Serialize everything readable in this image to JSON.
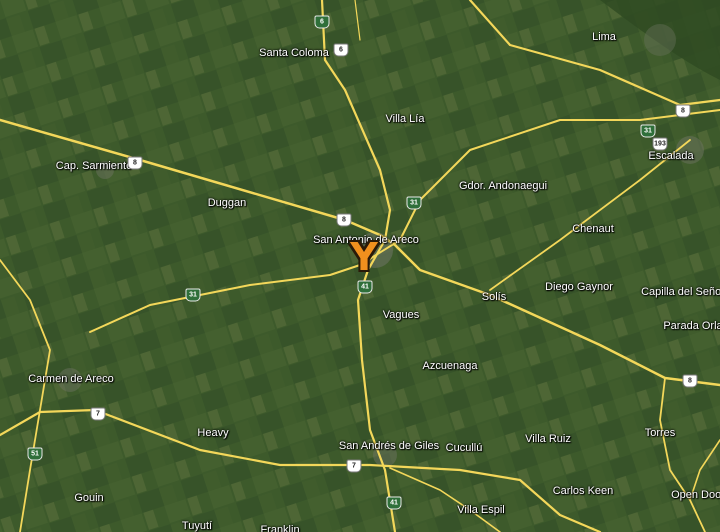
{
  "map": {
    "marker": {
      "glyph": "Y",
      "color": "#f0901e"
    },
    "road_color": "#f3d75a",
    "places": [
      {
        "id": "santa-coloma",
        "name": "Santa Coloma"
      },
      {
        "id": "lima",
        "name": "Lima"
      },
      {
        "id": "villa-lia",
        "name": "Villa Lía"
      },
      {
        "id": "cap-sarmiento",
        "name": "Cap. Sarmiento"
      },
      {
        "id": "escalada",
        "name": "Escalada"
      },
      {
        "id": "gdor-andonaegui",
        "name": "Gdor. Andonaegui"
      },
      {
        "id": "duggan",
        "name": "Duggan"
      },
      {
        "id": "san-antonio-de-areco",
        "name": "San Antonio de Areco"
      },
      {
        "id": "chenaut",
        "name": "Chenaut"
      },
      {
        "id": "solis",
        "name": "Solís"
      },
      {
        "id": "diego-gaynor",
        "name": "Diego Gaynor"
      },
      {
        "id": "capilla-del-senor",
        "name": "Capilla del Señor"
      },
      {
        "id": "vagues",
        "name": "Vagues"
      },
      {
        "id": "parada-orlando",
        "name": "Parada Orla"
      },
      {
        "id": "azcuenaga",
        "name": "Azcuenaga"
      },
      {
        "id": "carmen-de-areco",
        "name": "Carmen de Areco"
      },
      {
        "id": "heavy",
        "name": "Heavy"
      },
      {
        "id": "san-andres-de-giles",
        "name": "San Andrés de Giles"
      },
      {
        "id": "cucullu",
        "name": "Cucullú"
      },
      {
        "id": "villa-ruiz",
        "name": "Villa Ruiz"
      },
      {
        "id": "torres",
        "name": "Torres"
      },
      {
        "id": "carlos-keen",
        "name": "Carlos Keen"
      },
      {
        "id": "gouin",
        "name": "Gouin"
      },
      {
        "id": "open-door",
        "name": "Open Door"
      },
      {
        "id": "villa-espil",
        "name": "Villa Espil"
      },
      {
        "id": "tuyuti",
        "name": "Tuyutí"
      },
      {
        "id": "franklin",
        "name": "Franklin"
      }
    ],
    "shields": [
      {
        "id": "s8a",
        "number": "8",
        "style": "white"
      },
      {
        "id": "s8b",
        "number": "8",
        "style": "white"
      },
      {
        "id": "s8c",
        "number": "8",
        "style": "white"
      },
      {
        "id": "s8d",
        "number": "8",
        "style": "white"
      },
      {
        "id": "s31a",
        "number": "31",
        "style": "green"
      },
      {
        "id": "s31b",
        "number": "31",
        "style": "green"
      },
      {
        "id": "s31c",
        "number": "31",
        "style": "green"
      },
      {
        "id": "s41a",
        "number": "41",
        "style": "green"
      },
      {
        "id": "s41b",
        "number": "41",
        "style": "green"
      },
      {
        "id": "s7a",
        "number": "7",
        "style": "white"
      },
      {
        "id": "s7b",
        "number": "7",
        "style": "white"
      },
      {
        "id": "s51",
        "number": "51",
        "style": "green"
      },
      {
        "id": "s193",
        "number": "193",
        "style": "white"
      },
      {
        "id": "s6",
        "number": "6",
        "style": "white"
      },
      {
        "id": "s6b",
        "number": "6",
        "style": "green"
      }
    ]
  }
}
